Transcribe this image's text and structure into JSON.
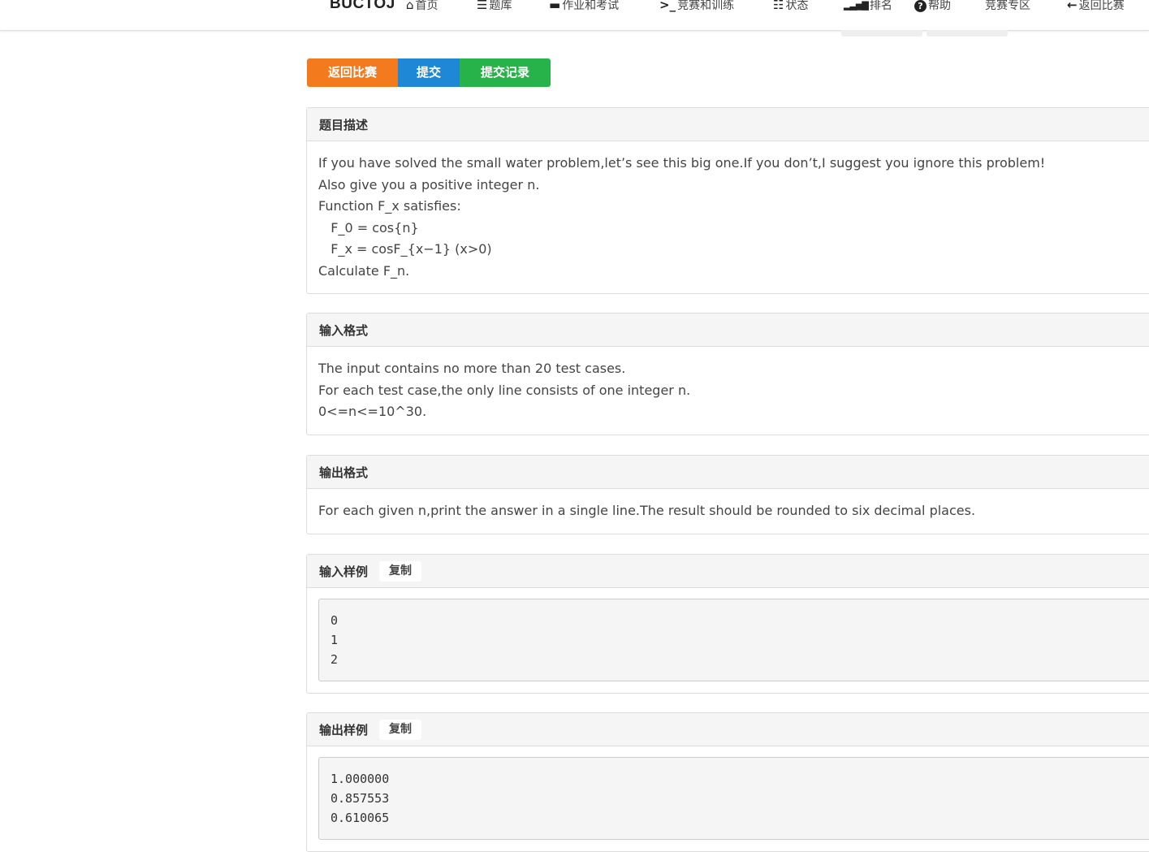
{
  "navbar": {
    "brand": "BUCTOJ",
    "items": [
      {
        "icon": "home-icon",
        "glyph": "🏠",
        "label": "首页"
      },
      {
        "icon": "list-icon",
        "glyph": "☰",
        "label": "题库"
      },
      {
        "icon": "book-icon",
        "glyph": "■",
        "label": "作业和考试"
      },
      {
        "icon": "terminal-icon",
        "glyph": ">_",
        "label": "竞赛和训练"
      },
      {
        "icon": "status-list-icon",
        "glyph": "☷",
        "label": "状态"
      },
      {
        "icon": "bar-chart-icon",
        "glyph": "▂▃▅▇",
        "label": "排名"
      },
      {
        "icon": "question-circle-icon",
        "glyph": "?",
        "label": "帮助"
      },
      {
        "icon": "",
        "glyph": "",
        "label": "竞赛专区"
      },
      {
        "icon": "arrow-left-icon",
        "glyph": "←",
        "label": "返回比赛"
      }
    ]
  },
  "actions": {
    "back_label": "返回比赛",
    "submit_label": "提交",
    "records_label": "提交记录",
    "colors": {
      "back": "#f37b1d",
      "submit": "#1e88d6",
      "records": "#28b34a"
    }
  },
  "description": {
    "title": "题目描述",
    "lines": [
      "If you have solved the small water problem,let’s see this big one.If you don’t,I suggest you ignore this problem!",
      "Also give you a positive integer n.",
      "Function F_x satisfies:",
      "   F_0 = cos{n}",
      "   F_x = cosF_{x−1} (x>0)",
      "Calculate F_n."
    ]
  },
  "input_format": {
    "title": "输入格式",
    "lines": [
      "The input contains no more than 20 test cases.",
      "For each test case,the only line consists of one integer n.",
      "0<=n<=10^30."
    ]
  },
  "output_format": {
    "title": "输出格式",
    "lines": [
      "For each given n,print the answer in a single line.The result should be rounded to six decimal places."
    ]
  },
  "sample_input": {
    "title": "输入样例",
    "copy_label": "复制",
    "lines": [
      "0",
      "1",
      "2"
    ]
  },
  "sample_output": {
    "title": "输出样例",
    "copy_label": "复制",
    "lines": [
      "1.000000",
      "0.857553",
      "0.610065"
    ]
  }
}
